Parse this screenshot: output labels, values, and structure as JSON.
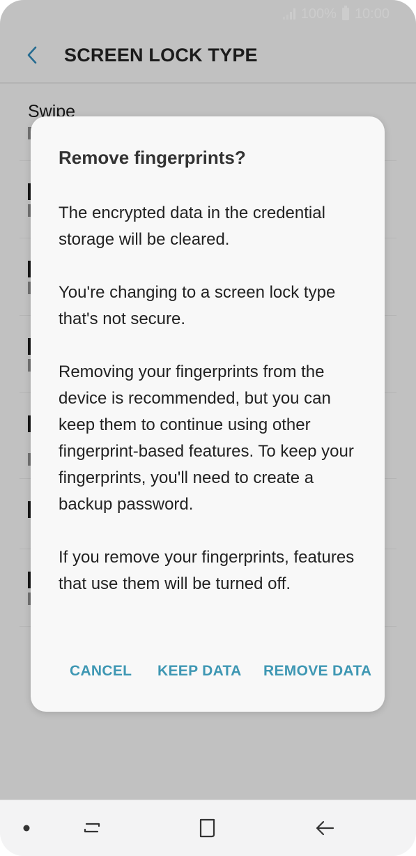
{
  "status_bar": {
    "battery": "100%",
    "time": "10:00",
    "icons": [
      "signal-icon",
      "battery-icon"
    ]
  },
  "header": {
    "title": "SCREEN LOCK TYPE",
    "back_icon": "chevron-left-icon"
  },
  "list": {
    "items": [
      {
        "title": "Swipe"
      }
    ]
  },
  "dialog": {
    "title": "Remove fingerprints?",
    "paragraphs": [
      "The encrypted data in the credential storage will be cleared.",
      "You're changing to a screen lock type that's not secure.",
      "Removing your fingerprints from the device is recommended, but you can keep them to continue using other fingerprint-based features. To keep your fingerprints, you'll need to create a backup password.",
      "If you remove your fingerprints, features that use them will be turned off."
    ],
    "buttons": {
      "cancel": "CANCEL",
      "keep": "KEEP DATA",
      "remove": "REMOVE DATA"
    },
    "accent_color": "#3e97b3"
  },
  "nav_bar": {
    "icons": [
      "dot-icon",
      "recents-icon",
      "home-icon",
      "back-arrow-icon"
    ]
  }
}
